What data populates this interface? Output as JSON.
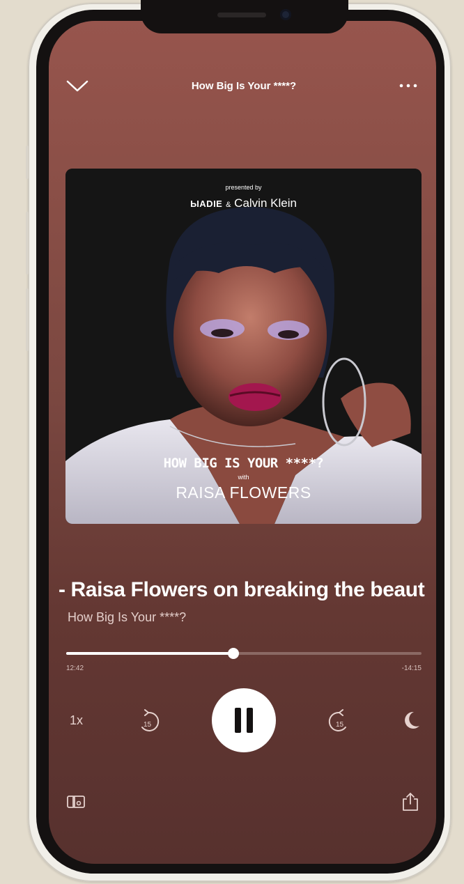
{
  "header": {
    "title": "How Big Is Your ****?"
  },
  "artwork": {
    "presented_by": "presented by",
    "brand_left": "ЫADIE",
    "brand_sep": "&",
    "brand_right": "Calvin Klein",
    "show_wordmark": "HOW BIG IS YOUR ****?",
    "with": "with",
    "guest": "RAISA FLOWERS"
  },
  "episode": {
    "title": "- Raisa Flowers on breaking the beaut",
    "show_name": "How Big Is Your ****?"
  },
  "progress": {
    "elapsed": "12:42",
    "remaining": "-14:15",
    "fraction": 0.47
  },
  "controls": {
    "speed": "1x",
    "skip_back_seconds": "15",
    "skip_forward_seconds": "15",
    "state": "playing"
  },
  "icons": {
    "collapse": "chevron-down-icon",
    "more": "more-dots-icon",
    "rewind": "skip-back-15-icon",
    "pause": "pause-icon",
    "forward": "skip-forward-15-icon",
    "sleep": "moon-icon",
    "devices": "connect-devices-icon",
    "share": "share-icon"
  },
  "colors": {
    "background_top": "#97554d",
    "background_bottom": "#57312e",
    "text_primary": "#ffffff",
    "text_secondary": "#e4cfcb"
  }
}
